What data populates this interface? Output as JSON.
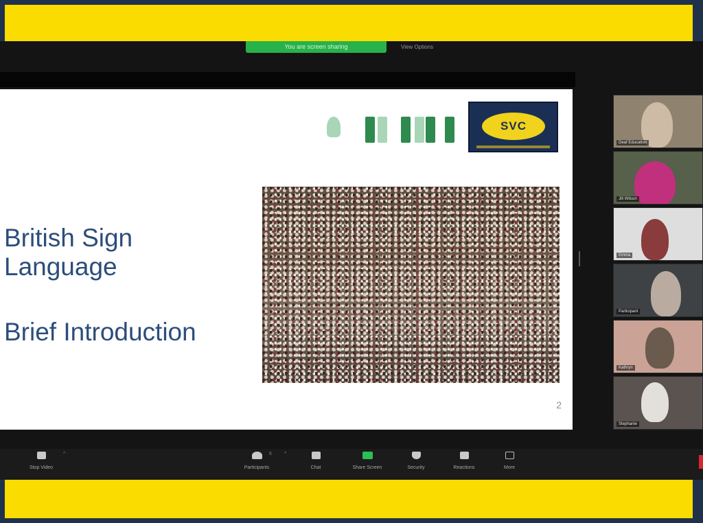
{
  "share_bar": {
    "label": "You are screen sharing",
    "view_options": "View Options"
  },
  "slide": {
    "title": "British Sign Language",
    "subtitle": "Brief Introduction",
    "page_number": "2",
    "logo_text": "SVC"
  },
  "gallery": {
    "participants": [
      {
        "name": "Deaf Education"
      },
      {
        "name": "Jill Wilson"
      },
      {
        "name": "Emma"
      },
      {
        "name": "Participant"
      },
      {
        "name": "Kathryn"
      },
      {
        "name": "Stephanie"
      }
    ]
  },
  "toolbar": {
    "stop_video": "Stop Video",
    "participants": "Participants",
    "participant_count": "6",
    "chat": "Chat",
    "share_screen": "Share Screen",
    "security": "Security",
    "reactions": "Reactions",
    "more": "More"
  },
  "colors": {
    "banner": "#fbdc00",
    "share_green": "#27b24a",
    "slide_text": "#2c4d7a",
    "svc_navy": "#1b2f55",
    "svc_yellow": "#f1d21c"
  }
}
